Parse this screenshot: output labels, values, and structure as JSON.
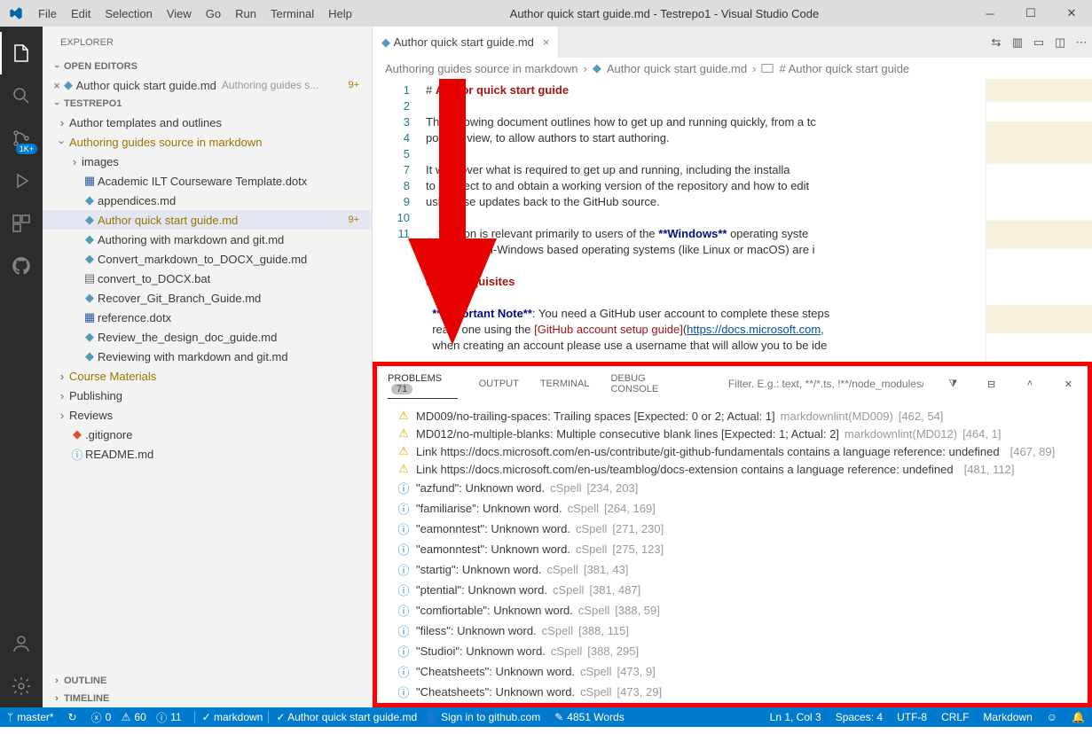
{
  "window": {
    "title": "Author quick start guide.md - Testrepo1 - Visual Studio Code"
  },
  "menu": [
    "File",
    "Edit",
    "Selection",
    "View",
    "Go",
    "Run",
    "Terminal",
    "Help"
  ],
  "activitybar": {
    "scm_badge": "1K+"
  },
  "sidebar": {
    "title": "EXPLORER",
    "sections": {
      "open": "OPEN EDITORS",
      "repo": "TESTREPO1",
      "outline": "OUTLINE",
      "timeline": "TIMELINE"
    },
    "open_editors": [
      {
        "name": "Author quick start guide.md",
        "extra": "Authoring guides s...",
        "badge": "9+"
      }
    ],
    "tree": [
      {
        "d": 1,
        "kind": "folder",
        "open": false,
        "label": "Author templates and outlines"
      },
      {
        "d": 1,
        "kind": "folder",
        "open": true,
        "label": "Authoring guides source in markdown",
        "mod": true
      },
      {
        "d": 2,
        "kind": "folder",
        "open": false,
        "label": "images"
      },
      {
        "d": 2,
        "kind": "file",
        "ic": "dotx",
        "label": "Academic ILT Courseware Template.dotx"
      },
      {
        "d": 2,
        "kind": "file",
        "ic": "md",
        "label": "appendices.md"
      },
      {
        "d": 2,
        "kind": "file",
        "ic": "md",
        "label": "Author quick start guide.md",
        "sel": true,
        "badge": "9+",
        "mod": true
      },
      {
        "d": 2,
        "kind": "file",
        "ic": "md",
        "label": "Authoring with markdown and git.md"
      },
      {
        "d": 2,
        "kind": "file",
        "ic": "md",
        "label": "Convert_markdown_to_DOCX_guide.md"
      },
      {
        "d": 2,
        "kind": "file",
        "ic": "bat",
        "label": "convert_to_DOCX.bat"
      },
      {
        "d": 2,
        "kind": "file",
        "ic": "md",
        "label": "Recover_Git_Branch_Guide.md"
      },
      {
        "d": 2,
        "kind": "file",
        "ic": "dotx",
        "label": "reference.dotx"
      },
      {
        "d": 2,
        "kind": "file",
        "ic": "md",
        "label": "Review_the_design_doc_guide.md"
      },
      {
        "d": 2,
        "kind": "file",
        "ic": "md",
        "label": "Reviewing with markdown and git.md"
      },
      {
        "d": 1,
        "kind": "folder",
        "open": false,
        "label": "Course Materials",
        "mod": true
      },
      {
        "d": 1,
        "kind": "folder",
        "open": false,
        "label": "Publishing"
      },
      {
        "d": 1,
        "kind": "folder",
        "open": false,
        "label": "Reviews"
      },
      {
        "d": 1,
        "kind": "file",
        "ic": "git",
        "label": ".gitignore"
      },
      {
        "d": 1,
        "kind": "file",
        "ic": "info",
        "label": "README.md"
      }
    ]
  },
  "tabs": [
    {
      "name": "Author quick start guide.md"
    }
  ],
  "breadcrumb": {
    "a": "Authoring guides source in markdown",
    "b": "Author quick start guide.md",
    "c": "# Author quick start guide"
  },
  "editor": {
    "lines": [
      {
        "n": 1,
        "html": "# <span class='mk-h'>Author quick start guide</span>"
      },
      {
        "n": 2,
        "html": ""
      },
      {
        "n": 3,
        "html": "The following document outlines how to get up and running quickly, from a tc"
      },
      {
        "n": 0,
        "html": "point of view, to allow authors to start authoring."
      },
      {
        "n": 4,
        "html": ""
      },
      {
        "n": 5,
        "html": "It will cover what is required to get up and running, including the installa"
      },
      {
        "n": 0,
        "html": "to connect to and obtain a working version of the repository and how to edit "
      },
      {
        "n": 0,
        "html": "ush those updates back to the GitHub source."
      },
      {
        "n": 7,
        "html": ""
      },
      {
        "n": 8,
        "html": "    fo   tion is relevant primarily to users of the <span class='mk-b'>**Windows**</span> operating syste"
      },
      {
        "n": 0,
        "html": "     ers of non-Windows based operating systems (like Linux or macOS) are i"
      },
      {
        "n": 0,
        "html": ""
      },
      {
        "n": 9,
        "html": "<span class='mk-h'>## Prerequisites</span>"
      },
      {
        "n": 10,
        "html": ""
      },
      {
        "n": 11,
        "html": "  <span class='mk-b'>**Important Note**</span>: You need a GitHub user account to complete these steps"
      },
      {
        "n": 0,
        "html": "  reate one using the <span class='mk-l'>[GitHub account setup guide]</span>(<span class='mk-u'>https://docs.microsoft.com</span>,"
      },
      {
        "n": 0,
        "html": "  when creating an account please use a username that will allow you to be ide"
      }
    ]
  },
  "panel": {
    "tabs": {
      "problems": "PROBLEMS",
      "output": "OUTPUT",
      "terminal": "TERMINAL",
      "debug": "DEBUG CONSOLE"
    },
    "problems_count": "71",
    "filter_placeholder": "Filter. E.g.: text, **/*.ts, !**/node_modules/**",
    "problems": [
      {
        "sev": "warn",
        "msg": "MD009/no-trailing-spaces: Trailing spaces [Expected: 0 or 2; Actual: 1]",
        "src": "markdownlint(MD009)",
        "loc": "[462, 54]"
      },
      {
        "sev": "warn",
        "msg": "MD012/no-multiple-blanks: Multiple consecutive blank lines [Expected: 1; Actual: 2]",
        "src": "markdownlint(MD012)",
        "loc": "[464, 1]"
      },
      {
        "sev": "warn",
        "msg": "Link https://docs.microsoft.com/en-us/contribute/git-github-fundamentals contains a language reference: undefined",
        "src": "",
        "loc": "[467, 89]"
      },
      {
        "sev": "warn",
        "msg": "Link https://docs.microsoft.com/en-us/teamblog/docs-extension contains a language reference: undefined",
        "src": "",
        "loc": "[481, 112]"
      },
      {
        "sev": "info",
        "msg": "\"azfund\": Unknown word.",
        "src": "cSpell",
        "loc": "[234, 203]"
      },
      {
        "sev": "info",
        "msg": "\"familiarise\": Unknown word.",
        "src": "cSpell",
        "loc": "[264, 169]"
      },
      {
        "sev": "info",
        "msg": "\"eamonntest\": Unknown word.",
        "src": "cSpell",
        "loc": "[271, 230]"
      },
      {
        "sev": "info",
        "msg": "\"eamonntest\": Unknown word.",
        "src": "cSpell",
        "loc": "[275, 123]"
      },
      {
        "sev": "info",
        "msg": "\"startig\": Unknown word.",
        "src": "cSpell",
        "loc": "[381, 43]"
      },
      {
        "sev": "info",
        "msg": "\"ptential\": Unknown word.",
        "src": "cSpell",
        "loc": "[381, 487]"
      },
      {
        "sev": "info",
        "msg": "\"comfiortable\": Unknown word.",
        "src": "cSpell",
        "loc": "[388, 59]"
      },
      {
        "sev": "info",
        "msg": "\"filess\": Unknown word.",
        "src": "cSpell",
        "loc": "[388, 115]"
      },
      {
        "sev": "info",
        "msg": "\"Studioi\": Unknown word.",
        "src": "cSpell",
        "loc": "[388, 295]"
      },
      {
        "sev": "info",
        "msg": "\"Cheatsheets\": Unknown word.",
        "src": "cSpell",
        "loc": "[473, 9]"
      },
      {
        "sev": "info",
        "msg": "\"Cheatsheets\": Unknown word.",
        "src": "cSpell",
        "loc": "[473, 29]"
      }
    ]
  },
  "status": {
    "branch": "master*",
    "sync": "↻",
    "errors": "0",
    "warnings": "60",
    "infos": "11",
    "lang_check": "✓ markdown",
    "file_check": "✓ Author quick start guide.md",
    "signin": "Sign in to github.com",
    "wordcount": "4851 Words",
    "cursor": "Ln 1, Col 3",
    "spaces": "Spaces: 4",
    "encoding": "UTF-8",
    "eol": "CRLF",
    "mode": "Markdown",
    "smile": "☺",
    "bell": "🔔"
  }
}
